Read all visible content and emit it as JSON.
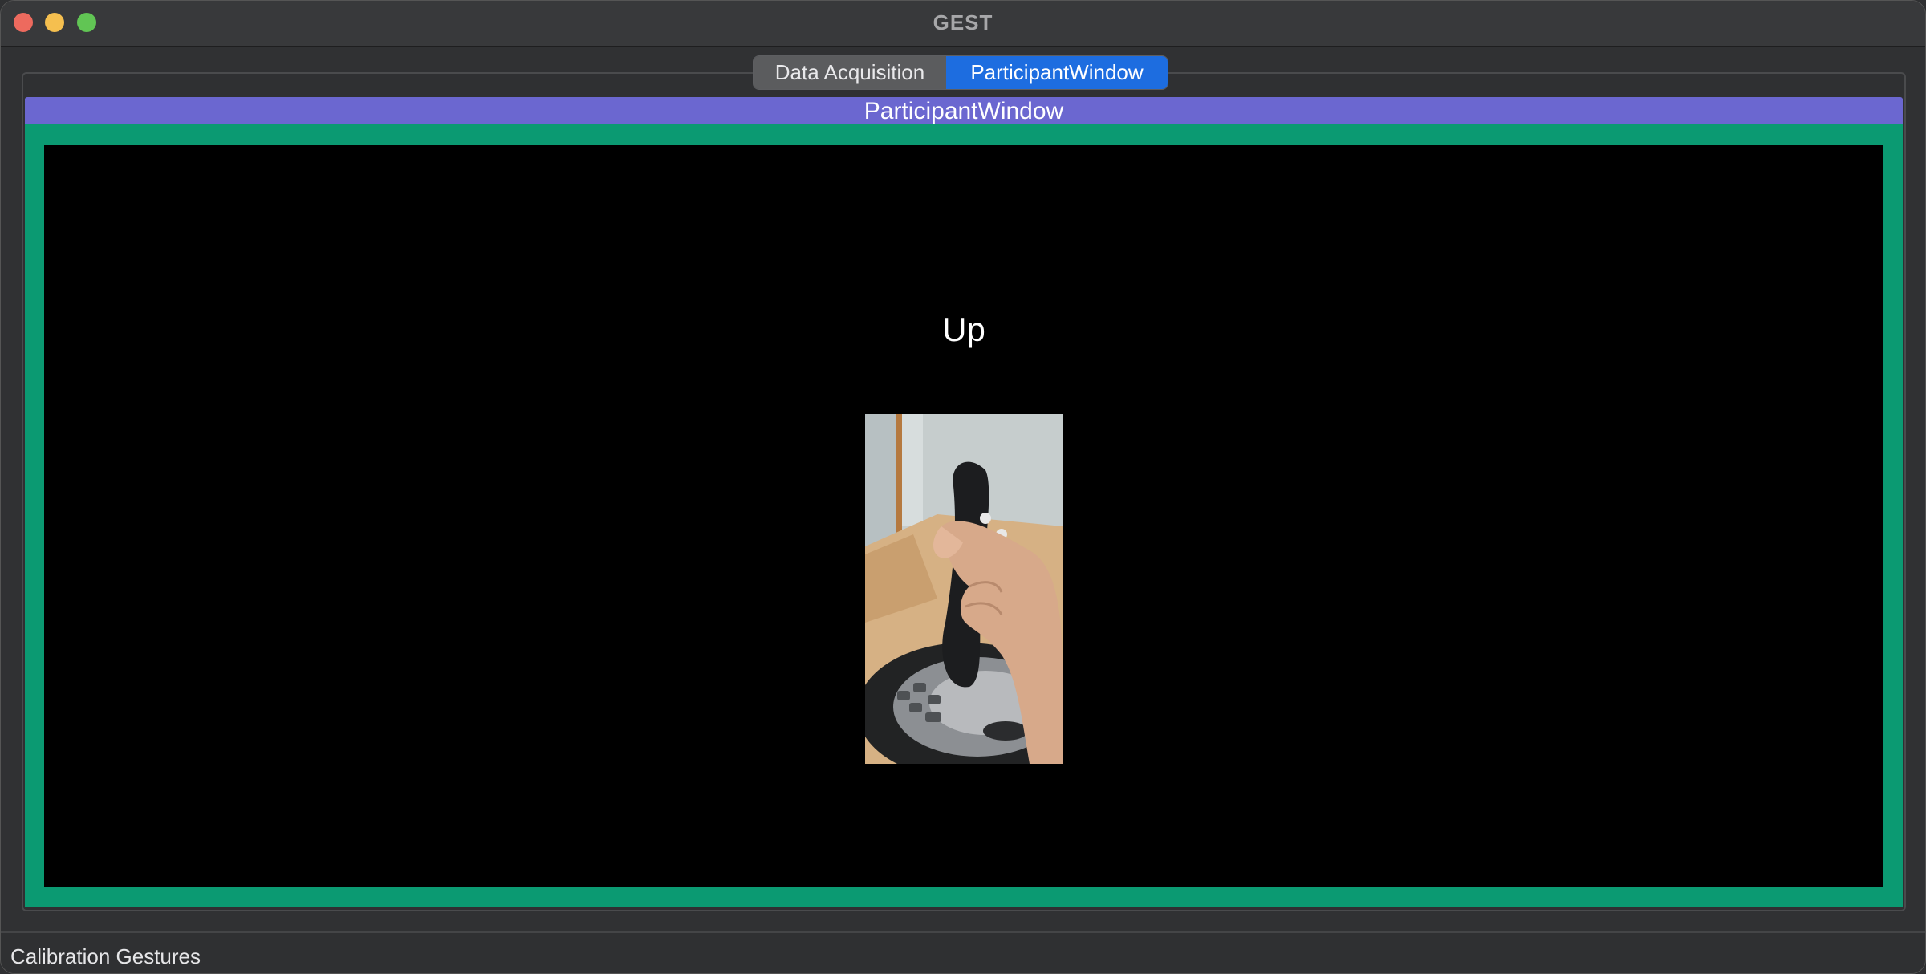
{
  "window": {
    "title": "GEST"
  },
  "tabs": [
    {
      "label": "Data Acquisition",
      "selected": false
    },
    {
      "label": "ParticipantWindow",
      "selected": true
    }
  ],
  "panel": {
    "header": "ParticipantWindow"
  },
  "stage": {
    "gesture_label": "Up",
    "image_subject": "hand-holding-joystick-photo"
  },
  "statusbar": {
    "text": "Calibration Gestures"
  },
  "colors": {
    "tab_selected": "#1d6de0",
    "panel_header": "#6b67d0",
    "frame_green": "#0b9a72",
    "stage_bg": "#000000"
  }
}
